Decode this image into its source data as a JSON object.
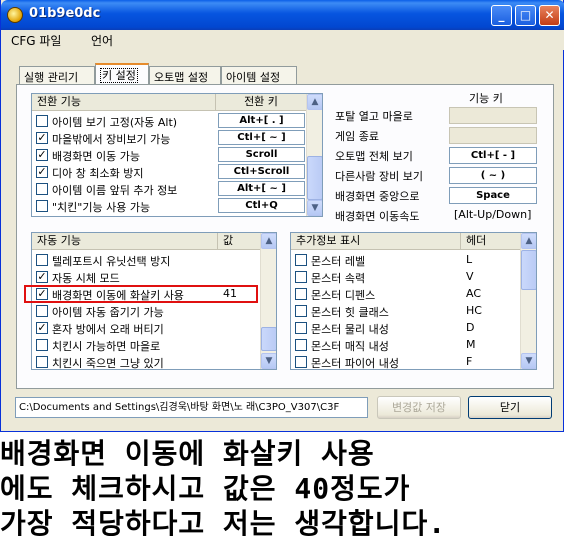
{
  "window": {
    "title": "01b9e0dc",
    "minimize": "_",
    "maximize": "□",
    "close": "✕"
  },
  "menu": [
    "CFG 파일",
    "언어"
  ],
  "tabs": [
    "실행 관리기",
    "키 설정",
    "오토맵 설정",
    "아이템 설정"
  ],
  "active_tab": 1,
  "toggle_list": {
    "headers": [
      "전환 기능",
      "전환 키"
    ],
    "rows": [
      {
        "label": "아이템 보기 고정(자동 Alt)",
        "checked": false,
        "key": "Alt+[ . ]"
      },
      {
        "label": "마을밖에서 장비보기 가능",
        "checked": true,
        "key": "Ctl+[ ~ ]"
      },
      {
        "label": "배경화면 이동 가능",
        "checked": true,
        "key": "Scroll"
      },
      {
        "label": "디아 창 최소화 방지",
        "checked": true,
        "key": "Ctl+Scroll"
      },
      {
        "label": "아이템 이름 앞뒤 추가 정보",
        "checked": false,
        "key": "Alt+[ ~ ]"
      },
      {
        "label": "\"치킨\"기능 사용 가능",
        "checked": false,
        "key": "Ctl+Q"
      }
    ]
  },
  "function_keys": {
    "header": "기능 키",
    "rows": [
      {
        "label": "포탈 열고 마을로",
        "key": ""
      },
      {
        "label": "게임 종료",
        "key": ""
      },
      {
        "label": "오토맵 전체 보기",
        "key": "Ctl+[ - ]"
      },
      {
        "label": "다른사람 장비 보기",
        "key": "( ~ )"
      },
      {
        "label": "배경화면 중앙으로",
        "key": "Space"
      },
      {
        "label": "배경화면 이동속도",
        "key": "[Alt-Up/Down]"
      }
    ]
  },
  "auto_list": {
    "headers": [
      "자동 기능",
      "값"
    ],
    "rows": [
      {
        "label": "텔레포트시 유닛선택 방지",
        "checked": false,
        "value": ""
      },
      {
        "label": "자동 시체 모드",
        "checked": true,
        "value": ""
      },
      {
        "label": "배경화면 이동에 화살키 사용",
        "checked": true,
        "value": "41"
      },
      {
        "label": "아이템 자동 줍기기 가능",
        "checked": false,
        "value": ""
      },
      {
        "label": "혼자 방에서 오래 버티기",
        "checked": true,
        "value": ""
      },
      {
        "label": "치킨시 가능하면 마을로",
        "checked": false,
        "value": ""
      },
      {
        "label": "치킨시 죽으면 그냥 있기",
        "checked": false,
        "value": ""
      }
    ]
  },
  "info_list": {
    "headers": [
      "추가정보 표시",
      "헤더"
    ],
    "rows": [
      {
        "label": "몬스터 레벨",
        "checked": false,
        "value": "L"
      },
      {
        "label": "몬스터 속력",
        "checked": false,
        "value": "V"
      },
      {
        "label": "몬스터 디펜스",
        "checked": false,
        "value": "AC"
      },
      {
        "label": "몬스터 힛 클래스",
        "checked": false,
        "value": "HC"
      },
      {
        "label": "몬스터 물리 내성",
        "checked": false,
        "value": "D"
      },
      {
        "label": "몬스터 매직 내성",
        "checked": false,
        "value": "M"
      },
      {
        "label": "몬스터 파이어 내성",
        "checked": false,
        "value": "F"
      }
    ]
  },
  "bottom": {
    "path": "C:\\Documents and Settings\\김경욱\\바탕 화면\\노 래\\C3PO_V307\\C3F",
    "save_label": "변경값 저장",
    "close_label": "닫기"
  },
  "caption": [
    "배경화면 이동에 화살키 사용",
    "에도 체크하시고 값은 40정도가",
    "가장 적당하다고 저는 생각합니다."
  ],
  "colors": {
    "titlebar": "#0054e3",
    "highlight": "#e01010",
    "face": "#ece9d8"
  }
}
